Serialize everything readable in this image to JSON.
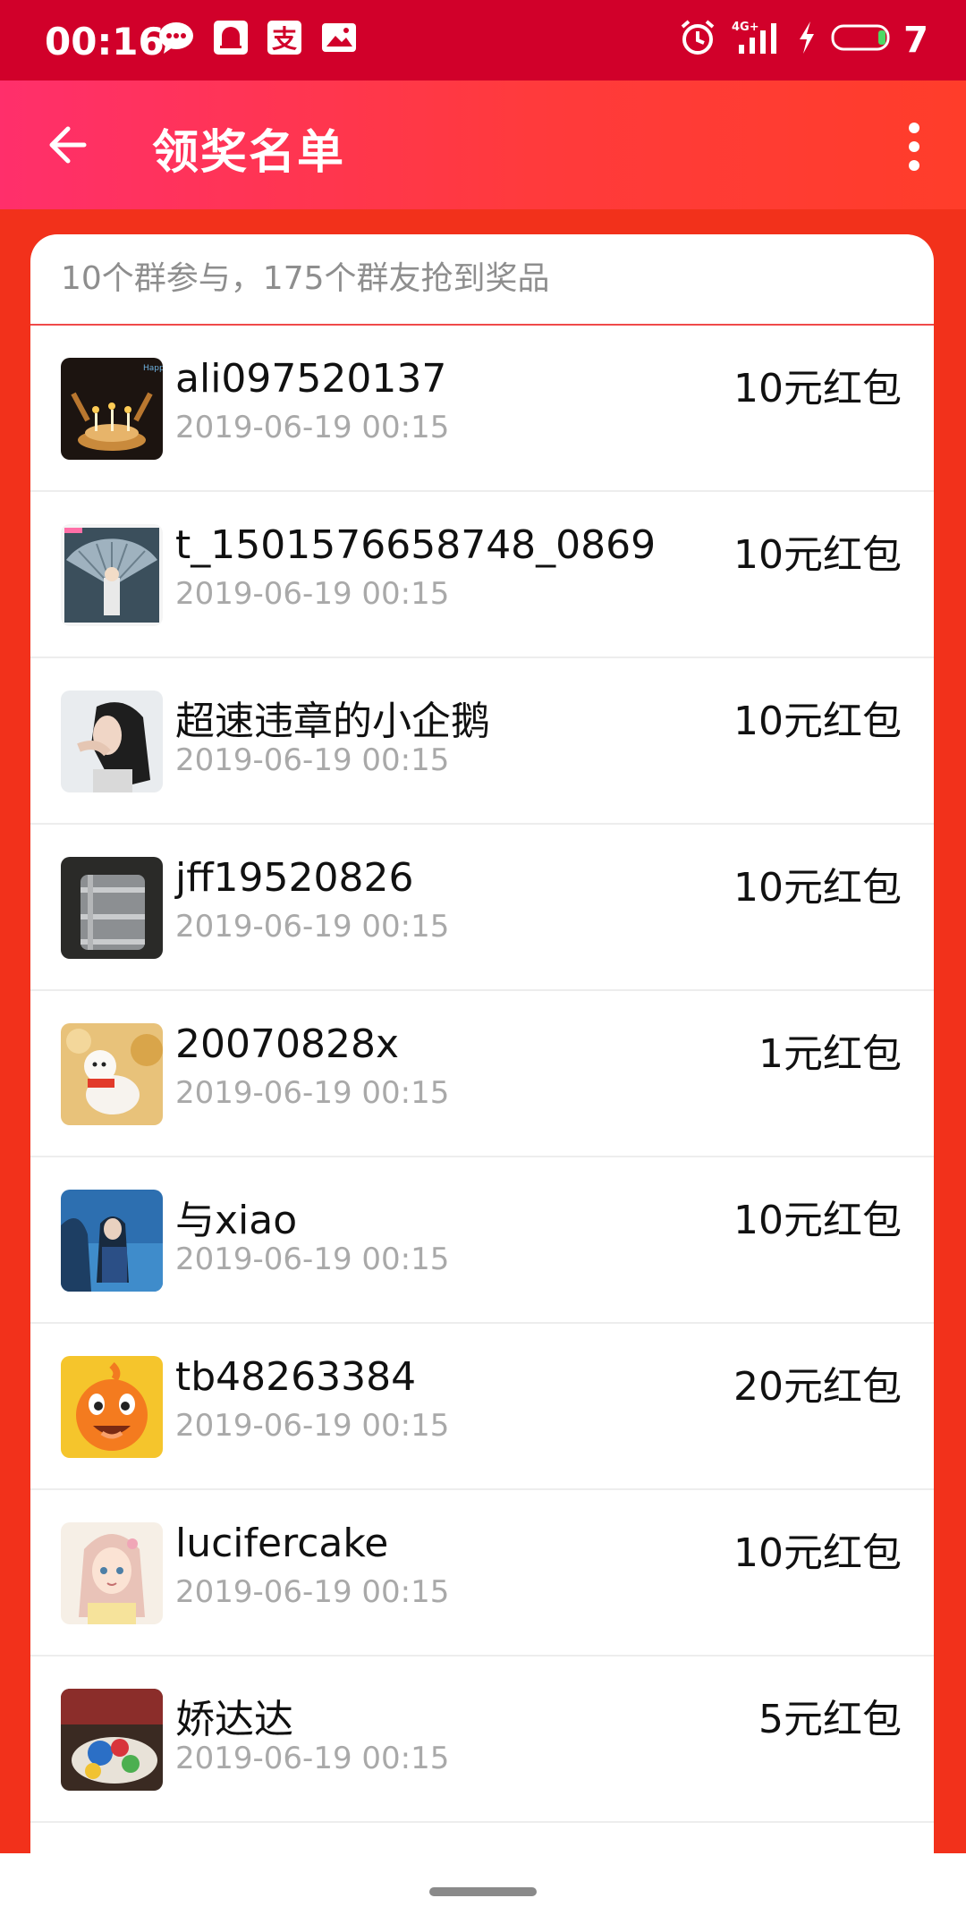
{
  "status_bar": {
    "time": "00:16",
    "network": "4G+",
    "battery_level": "7",
    "icons": [
      "message-icon",
      "notification-icon",
      "alipay-icon",
      "image-icon",
      "alarm-icon",
      "signal-icon",
      "charging-icon",
      "battery-icon"
    ]
  },
  "appbar": {
    "title": "领奖名单",
    "back_icon": "arrow-left-icon",
    "more_icon": "more-vertical-icon"
  },
  "summary": "10个群参与，175个群友抢到奖品",
  "winners": [
    {
      "name": "ali097520137",
      "date": "2019-06-19 00:15",
      "prize": "10元红包",
      "avatar": "birthday-cake-candles"
    },
    {
      "name": "t_1501576658748_0869",
      "date": "2019-06-19 00:15",
      "prize": "10元红包",
      "avatar": "fan-figure"
    },
    {
      "name": "超速违章的小企鹅",
      "date": "2019-06-19 00:15",
      "prize": "10元红包",
      "avatar": "woman-portrait"
    },
    {
      "name": "jff19520826",
      "date": "2019-06-19 00:15",
      "prize": "10元红包",
      "avatar": "steamer-pot"
    },
    {
      "name": "20070828x",
      "date": "2019-06-19 00:15",
      "prize": "1元红包",
      "avatar": "white-dog"
    },
    {
      "name": "与xiao",
      "date": "2019-06-19 00:15",
      "prize": "10元红包",
      "avatar": "girl-blue-background"
    },
    {
      "name": "tb48263384",
      "date": "2019-06-19 00:15",
      "prize": "20元红包",
      "avatar": "orange-mascot"
    },
    {
      "name": "lucifercake",
      "date": "2019-06-19 00:15",
      "prize": "10元红包",
      "avatar": "anime-girl"
    },
    {
      "name": "娇达达",
      "date": "2019-06-19 00:15",
      "prize": "5元红包",
      "avatar": "colorful-food"
    }
  ],
  "colors": {
    "status_bar": "#d1002a",
    "appbar_start": "#ff2f6b",
    "appbar_end": "#ff3d2a",
    "page_background": "#f2311b",
    "summary_divider": "#f04a4a"
  }
}
